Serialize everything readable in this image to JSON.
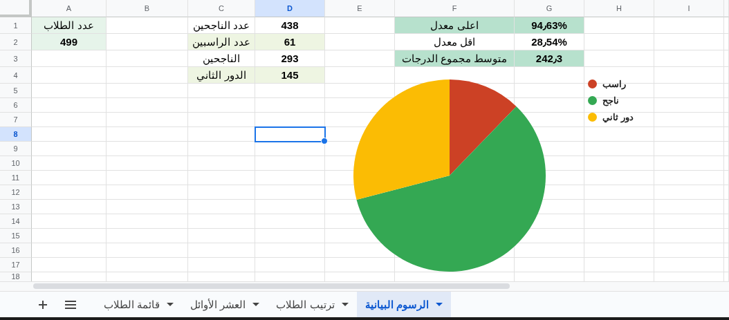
{
  "columns": [
    {
      "label": "I",
      "selected": false
    },
    {
      "label": "H",
      "selected": false
    },
    {
      "label": "G",
      "selected": false
    },
    {
      "label": "F",
      "selected": false
    },
    {
      "label": "E",
      "selected": false
    },
    {
      "label": "D",
      "selected": true
    },
    {
      "label": "C",
      "selected": false
    },
    {
      "label": "B",
      "selected": false
    },
    {
      "label": "A",
      "selected": false
    }
  ],
  "rows": [
    {
      "header": "1",
      "selected": false,
      "cells": [
        null,
        null,
        {
          "kind": "number",
          "text": "94٫63%",
          "color": "#b7e1cd"
        },
        {
          "kind": "label",
          "text": "اعلى معدل",
          "color": "#b7e1cd"
        },
        null,
        {
          "kind": "number",
          "text": "438"
        },
        {
          "kind": "label",
          "text": "عدد الناجحين"
        },
        null,
        {
          "kind": "label",
          "text": "عدد الطلاب",
          "color": "#e6f4ea"
        }
      ]
    },
    {
      "header": "2",
      "selected": false,
      "cells": [
        null,
        null,
        {
          "kind": "number",
          "text": "28٫54%"
        },
        {
          "kind": "label",
          "text": "اقل معدل"
        },
        null,
        {
          "kind": "number",
          "text": "61",
          "color": "#eef5e2"
        },
        {
          "kind": "label",
          "text": "عدد الراسبين",
          "color": "#eef5e2"
        },
        null,
        {
          "kind": "number",
          "text": "499",
          "color": "#e6f4ea"
        }
      ]
    },
    {
      "header": "3",
      "selected": false,
      "cells": [
        null,
        null,
        {
          "kind": "number",
          "text": "242٫3",
          "color": "#b7e1cd"
        },
        {
          "kind": "label",
          "text": "متوسط مجموع الدرجات",
          "color": "#b7e1cd"
        },
        null,
        {
          "kind": "number",
          "text": "293"
        },
        {
          "kind": "label",
          "text": "الناجحين"
        },
        null,
        null
      ]
    },
    {
      "header": "4",
      "selected": false,
      "cells": [
        null,
        null,
        null,
        null,
        null,
        {
          "kind": "number",
          "text": "145",
          "color": "#eef5e2"
        },
        {
          "kind": "label",
          "text": "الدور الثاني",
          "color": "#eef5e2"
        },
        null,
        null
      ]
    },
    {
      "header": "5",
      "selected": false
    },
    {
      "header": "6",
      "selected": false
    },
    {
      "header": "7",
      "selected": false
    },
    {
      "header": "8",
      "selected": true
    },
    {
      "header": "9",
      "selected": false
    },
    {
      "header": "10",
      "selected": false
    },
    {
      "header": "11",
      "selected": false
    },
    {
      "header": "12",
      "selected": false
    },
    {
      "header": "13",
      "selected": false
    },
    {
      "header": "14",
      "selected": false
    },
    {
      "header": "15",
      "selected": false
    },
    {
      "header": "16",
      "selected": false
    },
    {
      "header": "17",
      "selected": false
    },
    {
      "header": "18",
      "selected": false
    }
  ],
  "chart": {
    "chart_data": {
      "type": "pie",
      "categories": [
        "راسب",
        "ناجح",
        "دور ثاني"
      ],
      "values": [
        12.22,
        58.72,
        29.06
      ],
      "colors": [
        "#cc4125",
        "#34a853",
        "#fbbc04"
      ],
      "legend": "right"
    }
  },
  "sheet_tabs": [
    {
      "label": "الرسوم البيانية",
      "selected": true
    },
    {
      "label": "ترتيب الطلاب",
      "selected": false
    },
    {
      "label": "العشر الأوائل",
      "selected": false
    },
    {
      "label": "قائمة الطلاب",
      "selected": false
    }
  ]
}
